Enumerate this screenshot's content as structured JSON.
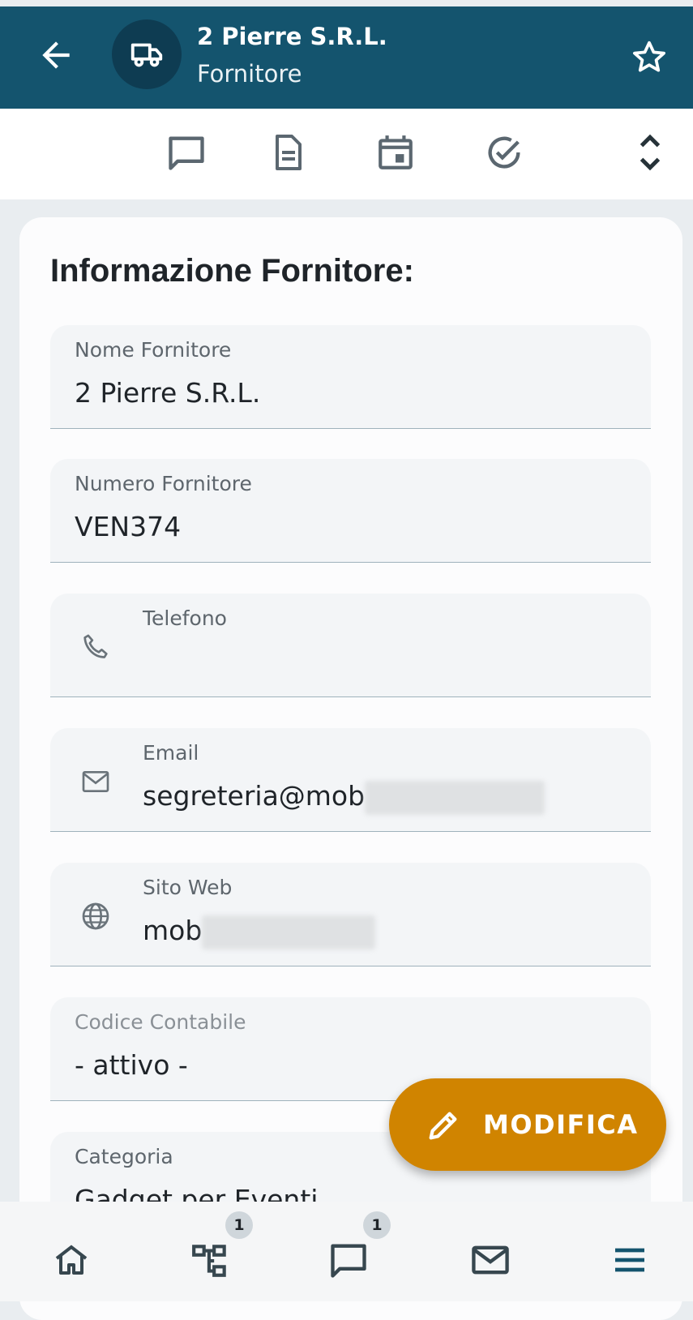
{
  "header": {
    "title": "2 Pierre S.R.L.",
    "subtitle": "Fornitore",
    "colors": {
      "bar": "#14546e",
      "avatar": "#0e3c52"
    },
    "icons": {
      "back": "arrow-left-icon",
      "avatar": "truck-icon",
      "favorite": "star-outline-icon"
    }
  },
  "toolbar": {
    "icons": [
      "chat-bubble-icon",
      "document-icon",
      "calendar-icon",
      "check-circle-icon",
      "expand-collapse-icon"
    ]
  },
  "card": {
    "title": "Informazione Fornitore:",
    "fields": [
      {
        "label": "Nome Fornitore",
        "value": "2 Pierre S.R.L."
      },
      {
        "label": "Numero Fornitore",
        "value": "VEN374"
      },
      {
        "label": "Telefono",
        "value": "",
        "icon": "phone-icon"
      },
      {
        "label": "Email",
        "value": "segreteria@mob",
        "icon": "mail-icon",
        "redacted": true
      },
      {
        "label": "Sito Web",
        "value": "mob",
        "icon": "globe-icon",
        "redacted": true
      },
      {
        "label": "Codice Contabile",
        "value": "- attivo -"
      },
      {
        "label": "Categoria",
        "value": "Gadget per Eventi"
      }
    ]
  },
  "fab": {
    "label": "MODIFICA",
    "icon": "pencil-icon",
    "color": "#d08400"
  },
  "bottom_nav": {
    "items": [
      {
        "icon": "home-icon"
      },
      {
        "icon": "hierarchy-icon",
        "badge": "1"
      },
      {
        "icon": "chat-bubble-icon",
        "badge": "1"
      },
      {
        "icon": "mail-icon"
      },
      {
        "icon": "menu-icon"
      }
    ]
  }
}
